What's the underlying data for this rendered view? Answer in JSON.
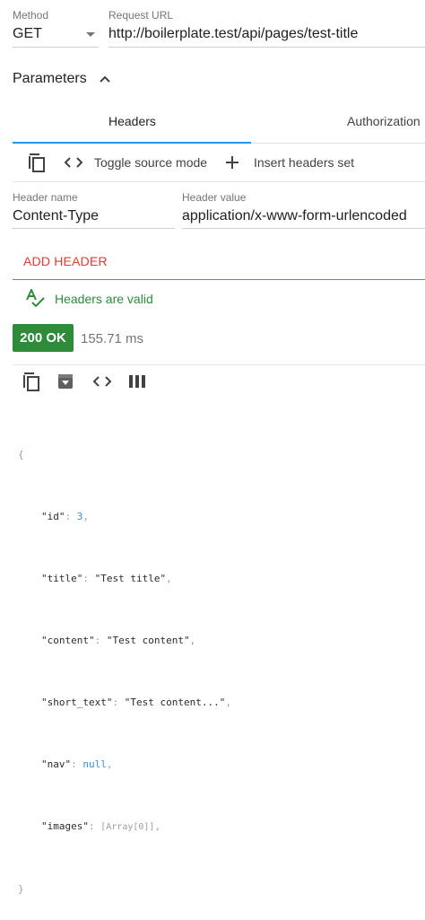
{
  "request": {
    "method_label": "Method",
    "method_value": "GET",
    "url_label": "Request URL",
    "url_value": "http://boilerplate.test/api/pages/test-title"
  },
  "parameters": {
    "label": "Parameters"
  },
  "tabs": [
    {
      "label": "Headers",
      "active": true
    },
    {
      "label": "Authorization",
      "active": false
    }
  ],
  "headers_toolbar": {
    "toggle_label": "Toggle source mode",
    "insert_label": "Insert headers set"
  },
  "header_row": {
    "name_label": "Header name",
    "name_value": "Content-Type",
    "value_label": "Header value",
    "value_value": "application/x-www-form-urlencoded"
  },
  "add_header_label": "ADD HEADER",
  "validation": {
    "text": "Headers are valid"
  },
  "response": {
    "status": "200 OK",
    "time": "155.71 ms"
  },
  "json_body": {
    "open": "{",
    "close": "}",
    "lines": [
      {
        "key": "\"id\"",
        "value": "3",
        "type": "number"
      },
      {
        "key": "\"title\"",
        "value": "\"Test title\"",
        "type": "string"
      },
      {
        "key": "\"content\"",
        "value": "\"Test content\"",
        "type": "string"
      },
      {
        "key": "\"short_text\"",
        "value": "\"Test content...\"",
        "type": "string"
      },
      {
        "key": "\"nav\"",
        "value": "null",
        "type": "null"
      },
      {
        "key": "\"images\"",
        "value": "[Array[0]]",
        "type": "array"
      }
    ]
  },
  "colors": {
    "accent": "#2196f3",
    "success": "#2e8b3a",
    "danger": "#e53935"
  }
}
